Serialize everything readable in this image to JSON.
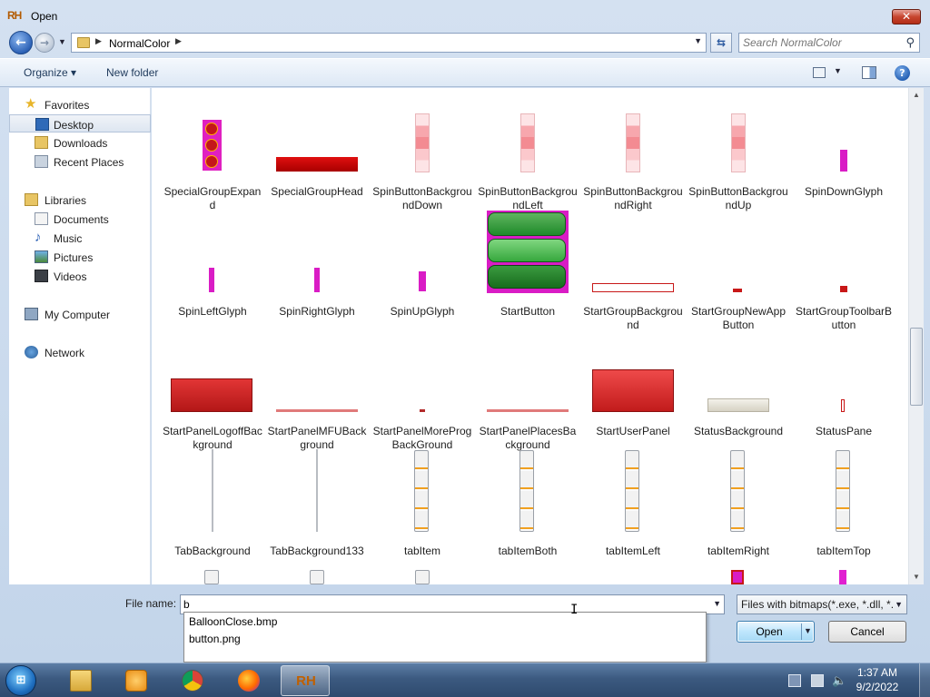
{
  "window": {
    "title": "Open",
    "app_icon": "RH"
  },
  "nav": {
    "back_label": "←",
    "forward_label": "→",
    "breadcrumb": "NormalColor",
    "search_placeholder": "Search NormalColor"
  },
  "toolbar": {
    "organize": "Organize ▾",
    "new_folder": "New folder",
    "help": "?"
  },
  "sidebar": {
    "favorites": "Favorites",
    "desktop": "Desktop",
    "downloads": "Downloads",
    "recent": "Recent Places",
    "libraries": "Libraries",
    "documents": "Documents",
    "music": "Music",
    "pictures": "Pictures",
    "videos": "Videos",
    "computer": "My Computer",
    "network": "Network"
  },
  "files": [
    "SpecialGroupExpand",
    "SpecialGroupHead",
    "SpinButtonBackgroundDown",
    "SpinButtonBackgroundLeft",
    "SpinButtonBackgroundRight",
    "SpinButtonBackgroundUp",
    "SpinDownGlyph",
    "SpinLeftGlyph",
    "SpinRightGlyph",
    "SpinUpGlyph",
    "StartButton",
    "StartGroupBackground",
    "StartGroupNewAppButton",
    "StartGroupToolbarButton",
    "StartPanelLogoffBackground",
    "StartPanelMFUBackground",
    "StartPanelMoreProgBackGround",
    "StartPanelPlacesBackground",
    "StartUserPanel",
    "StatusBackground",
    "StatusPane",
    "TabBackground",
    "TabBackground133",
    "tabItem",
    "tabItemBoth",
    "tabItemLeft",
    "tabItemRight",
    "tabItemTop"
  ],
  "bottom": {
    "filename_label": "File name:",
    "filename_value": "b",
    "filetype": "Files with bitmaps(*.exe, *.dll, *.",
    "suggestions": [
      "BalloonClose.bmp",
      "button.png"
    ],
    "open": "Open",
    "cancel": "Cancel"
  },
  "taskbar": {
    "time": "1:37 AM",
    "date": "9/2/2022",
    "start": "⊞"
  },
  "colors": {
    "accent": "#2d62b6",
    "selection": "#dde6f1"
  }
}
